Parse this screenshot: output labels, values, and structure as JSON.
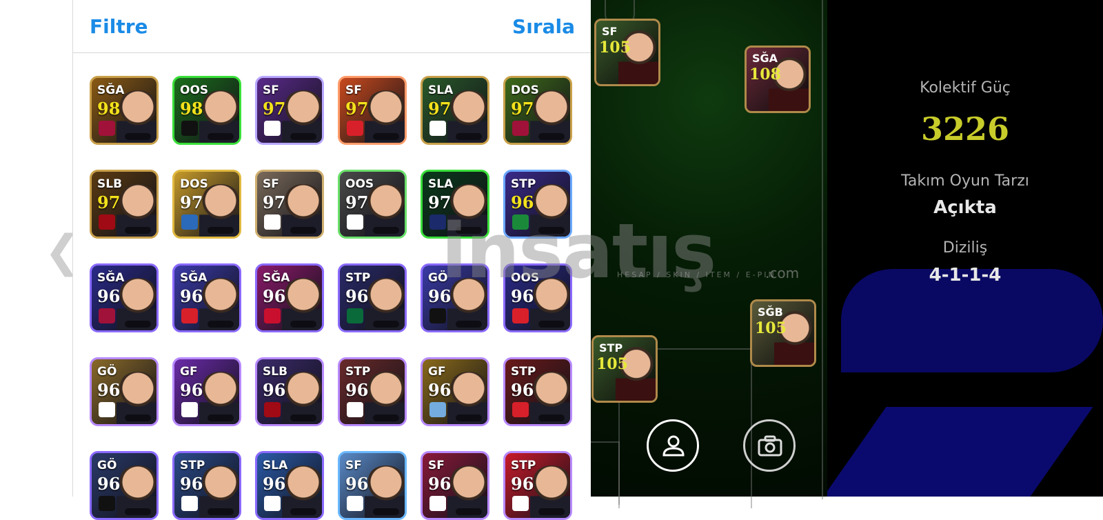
{
  "header": {
    "filter_label": "Filtre",
    "sort_label": "Sırala"
  },
  "nav": {
    "back_icon": "chevron-left-icon",
    "back_glyph": "❮"
  },
  "players": [
    {
      "pos": "SĞA",
      "rating": "98",
      "border": "#c9a04a",
      "bg": "#8a5a14",
      "badge": "#a0123a",
      "gold": true
    },
    {
      "pos": "OOS",
      "rating": "98",
      "border": "#3adf3a",
      "bg": "#1c6d1c",
      "badge": "#111111",
      "gold": true
    },
    {
      "pos": "SF",
      "rating": "97",
      "border": "#b8a7ff",
      "bg": "#5a2a8a",
      "badge": "#ffffff",
      "gold": true
    },
    {
      "pos": "SF",
      "rating": "97",
      "border": "#ff9c6a",
      "bg": "#c84a1e",
      "badge": "#d8202a",
      "gold": true
    },
    {
      "pos": "SLA",
      "rating": "97",
      "border": "#c9a04a",
      "bg": "#2a5a2a",
      "badge": "#ffffff",
      "gold": true
    },
    {
      "pos": "DOS",
      "rating": "97",
      "border": "#c9a04a",
      "bg": "#3e6a1a",
      "badge": "#a0123a",
      "gold": true
    },
    {
      "pos": "SLB",
      "rating": "97",
      "border": "#c9a04a",
      "bg": "#5a3a12",
      "badge": "#a00a14",
      "gold": true
    },
    {
      "pos": "DOS",
      "rating": "97",
      "border": "#e0b940",
      "bg": "#c69a2a",
      "badge": "#2a6ab8",
      "gold": false
    },
    {
      "pos": "SF",
      "rating": "97",
      "border": "#d0b070",
      "bg": "#7a6a5a",
      "badge": "#ffffff",
      "gold": false
    },
    {
      "pos": "OOS",
      "rating": "97",
      "border": "#6ae06a",
      "bg": "#4a4a4a",
      "badge": "#ffffff",
      "gold": false
    },
    {
      "pos": "SLA",
      "rating": "97",
      "border": "#3adf3a",
      "bg": "#0a3a1a",
      "badge": "#1a2a6a",
      "gold": false
    },
    {
      "pos": "STP",
      "rating": "96",
      "border": "#6aa8ff",
      "bg": "#3a2a8a",
      "badge": "#1a8a3a",
      "gold": true
    },
    {
      "pos": "SĞA",
      "rating": "96",
      "border": "#8a6aff",
      "bg": "#2a2a8a",
      "badge": "#a0123a",
      "gold": false
    },
    {
      "pos": "SĞA",
      "rating": "96",
      "border": "#8a6aff",
      "bg": "#3a3aa8",
      "badge": "#d8202a",
      "gold": false
    },
    {
      "pos": "SĞA",
      "rating": "96",
      "border": "#8a6aff",
      "bg": "#8a1a6a",
      "badge": "#c8102e",
      "gold": false
    },
    {
      "pos": "STP",
      "rating": "96",
      "border": "#8a6aff",
      "bg": "#2a2a6a",
      "badge": "#0a6a3a",
      "gold": false
    },
    {
      "pos": "GÖ",
      "rating": "96",
      "border": "#8a6aff",
      "bg": "#3a3aa8",
      "badge": "#111111",
      "gold": false
    },
    {
      "pos": "OOS",
      "rating": "96",
      "border": "#8a6aff",
      "bg": "#2a2a8a",
      "badge": "#d8202a",
      "gold": false
    },
    {
      "pos": "GÖ",
      "rating": "96",
      "border": "#b88aff",
      "bg": "#8a6a2a",
      "badge": "#ffffff",
      "gold": false
    },
    {
      "pos": "GF",
      "rating": "96",
      "border": "#b88aff",
      "bg": "#6a2aa8",
      "badge": "#ffffff",
      "gold": false
    },
    {
      "pos": "SLB",
      "rating": "96",
      "border": "#b88aff",
      "bg": "#3a2a6a",
      "badge": "#a00a14",
      "gold": false
    },
    {
      "pos": "STP",
      "rating": "96",
      "border": "#b88aff",
      "bg": "#6a2a2a",
      "badge": "#ffffff",
      "gold": false
    },
    {
      "pos": "GF",
      "rating": "96",
      "border": "#b88aff",
      "bg": "#8a6a1a",
      "badge": "#74acdf",
      "gold": false
    },
    {
      "pos": "STP",
      "rating": "96",
      "border": "#b88aff",
      "bg": "#6a1a1a",
      "badge": "#d8202a",
      "gold": false
    },
    {
      "pos": "GÖ",
      "rating": "96",
      "border": "#8a6aff",
      "bg": "#2a3a6a",
      "badge": "#111111",
      "gold": false
    },
    {
      "pos": "STP",
      "rating": "96",
      "border": "#8a6aff",
      "bg": "#2a4a8a",
      "badge": "#ffffff",
      "gold": false
    },
    {
      "pos": "SLA",
      "rating": "96",
      "border": "#8a6aff",
      "bg": "#2a5aa8",
      "badge": "#ffffff",
      "gold": false
    },
    {
      "pos": "SF",
      "rating": "96",
      "border": "#6ab8ff",
      "bg": "#5a8ac8",
      "badge": "#ffffff",
      "gold": false
    },
    {
      "pos": "SF",
      "rating": "96",
      "border": "#b88aff",
      "bg": "#8a1a3a",
      "badge": "#ffffff",
      "gold": false
    },
    {
      "pos": "STP",
      "rating": "96",
      "border": "#b88aff",
      "bg": "#c81a2a",
      "badge": "#ffffff",
      "gold": false
    }
  ],
  "pitch_players": [
    {
      "pos": "SF",
      "rating": "105",
      "bg": "#3a5a2a",
      "border": "#b08a4a"
    },
    {
      "pos": "SĞA",
      "rating": "108",
      "bg": "#6a2a3a",
      "border": "#b08a4a"
    },
    {
      "pos": "SĞB",
      "rating": "105",
      "bg": "#5a5a3a",
      "border": "#b08a4a"
    },
    {
      "pos": "STP",
      "rating": "105",
      "bg": "#3a5a2a",
      "border": "#b08a4a"
    }
  ],
  "controls": {
    "profile_icon": "person-icon",
    "camera_icon": "camera-icon"
  },
  "stats": {
    "kolektif_label": "Kolektif Güç",
    "kolektif_value": "3226",
    "oyun_tarzi_label": "Takım Oyun Tarzı",
    "oyun_tarzi_value": "Açıkta",
    "dizilis_label": "Diziliş",
    "dizilis_value": "4-1-1-4"
  },
  "watermark": {
    "main": "insatış",
    "sub": "HESAP / SKIN / ITEM / E-PIN",
    "com": ".com"
  },
  "colors": {
    "accent_blue": "#1a8be6",
    "power_yellow": "#c8cc2a",
    "deco_blue": "#0a0a6e"
  }
}
